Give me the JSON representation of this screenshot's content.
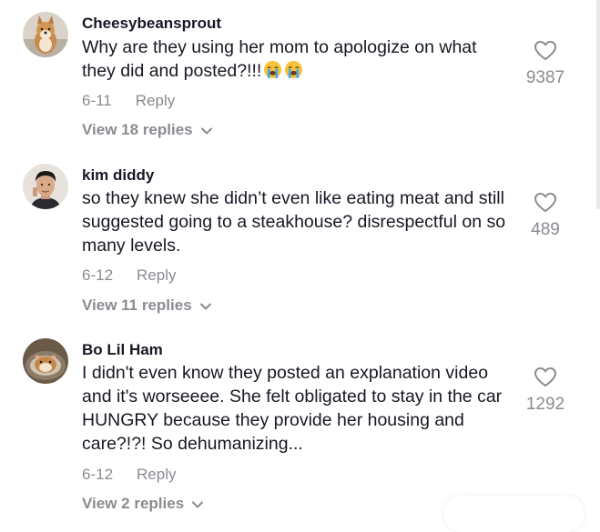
{
  "comments": [
    {
      "username": "Cheesybeansprout",
      "avatar": "shiba-dog-photo",
      "text": "Why are they using her mom to apologize on what they did and posted?!!!",
      "emojis": [
        "loudly-crying-face",
        "loudly-crying-face"
      ],
      "date": "6-11",
      "reply_label": "Reply",
      "likes": "9387",
      "view_replies": "View 18 replies"
    },
    {
      "username": "kim diddy",
      "avatar": "man-portrait-photo",
      "text": "so they knew she didn’t even like eating meat and still suggested going to a steakhouse? disrespectful on so many levels.",
      "date": "6-12",
      "reply_label": "Reply",
      "likes": "489",
      "view_replies": "View 11 replies"
    },
    {
      "username": "Bo Lil Ham",
      "avatar": "hamster-photo",
      "text": "I didn't even know they posted an explanation video and it's worseeee. She felt obligated to stay in the car HUNGRY because they provide her housing and care?!?! So dehumanizing...",
      "date": "6-12",
      "reply_label": "Reply",
      "likes": "1292",
      "view_replies": "View 2 replies"
    }
  ],
  "icons": {
    "like": "heart-outline-icon",
    "expand": "chevron-down-icon",
    "emoji": "loudly-crying-face-emoji"
  },
  "colors": {
    "primary_text": "#161823",
    "secondary_text": "#8a8b91",
    "background": "#ffffff"
  }
}
